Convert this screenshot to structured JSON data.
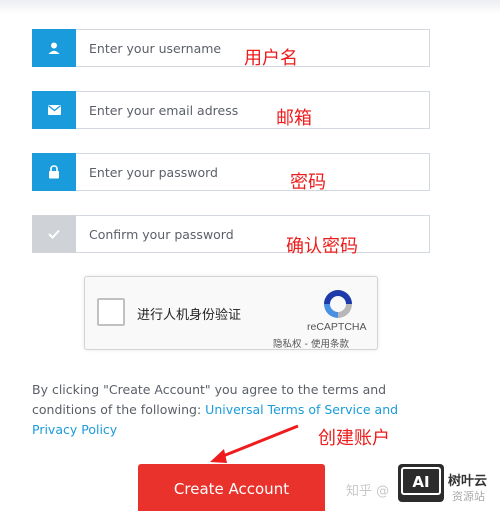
{
  "form": {
    "username": {
      "placeholder": "Enter your username",
      "annotation": "用户名",
      "icon": "user-icon"
    },
    "email": {
      "placeholder": "Enter your email adress",
      "annotation": "邮箱",
      "icon": "envelope-icon"
    },
    "password": {
      "placeholder": "Enter your password",
      "annotation": "密码",
      "icon": "lock-icon"
    },
    "confirm": {
      "placeholder": "Confirm your password",
      "annotation": "确认密码",
      "icon": "check-icon"
    }
  },
  "captcha": {
    "label": "进行人机身份验证",
    "brand": "reCAPTCHA",
    "links": "隐私权 - 使用条款"
  },
  "terms": {
    "prefix": "By clicking \"Create Account\" you agree to the terms and conditions of the following: ",
    "link_text": "Universal Terms of Service and Privacy Policy"
  },
  "submit": {
    "label": "Create Account",
    "annotation": "创建账户"
  },
  "watermark": {
    "text": "知乎 @",
    "logo": "AI",
    "brand": "树叶云",
    "sub": "资源站"
  },
  "colors": {
    "accent": "#1a9bdc",
    "disabled": "#cfd2d6",
    "button": "#e8322b",
    "annotation": "#ee1c1c"
  }
}
